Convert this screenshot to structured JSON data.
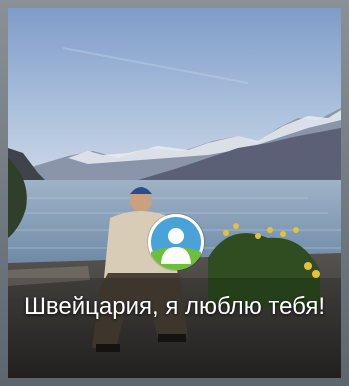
{
  "post": {
    "caption": "Швейцария, я люблю тебя!",
    "avatar_icon": "user-placeholder-icon",
    "colors": {
      "sky_top": "#7f9cc8",
      "lake": "#8aa0b8",
      "avatar_ring": "#ffffff",
      "avatar_bg": "#4aa3d8",
      "avatar_grass": "#6bbf3a"
    }
  }
}
